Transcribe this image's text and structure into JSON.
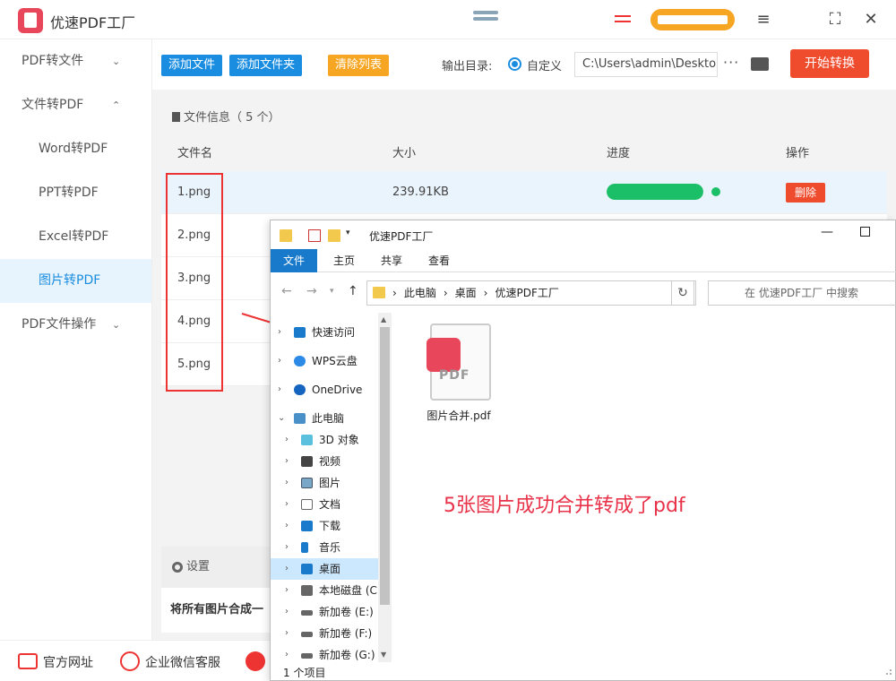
{
  "app": {
    "title": "优速PDF工厂"
  },
  "sidebar": {
    "items": [
      {
        "label": "PDF转文件",
        "chevron": "⌄"
      },
      {
        "label": "文件转PDF",
        "chevron": "⌃"
      },
      {
        "label": "Word转PDF"
      },
      {
        "label": "PPT转PDF"
      },
      {
        "label": "Excel转PDF"
      },
      {
        "label": "图片转PDF"
      },
      {
        "label": "PDF文件操作",
        "chevron": "⌄"
      }
    ]
  },
  "toolbar": {
    "add_file": "添加文件",
    "add_folder": "添加文件夹",
    "clear_list": "清除列表",
    "output_label": "输出目录:",
    "custom_label": "自定义",
    "output_path": "C:\\Users\\admin\\Deskto",
    "more": "···",
    "start": "开始转换"
  },
  "file_info": {
    "label": "文件信息（ 5 个）"
  },
  "table": {
    "headers": {
      "name": "文件名",
      "size": "大小",
      "progress": "进度",
      "action": "操作"
    },
    "rows": [
      {
        "name": "1.png",
        "size": "239.91KB",
        "progress": 1.0,
        "action": "删除"
      },
      {
        "name": "2.png"
      },
      {
        "name": "3.png"
      },
      {
        "name": "4.png"
      },
      {
        "name": "5.png"
      }
    ]
  },
  "settings": {
    "label": "设置",
    "text": "将所有图片合成一"
  },
  "footer": {
    "website": "官方网址",
    "wechat": "企业微信客服"
  },
  "explorer": {
    "title": "优速PDF工厂",
    "ribbon": [
      "文件",
      "主页",
      "共享",
      "查看"
    ],
    "breadcrumb": [
      "此电脑",
      "桌面",
      "优速PDF工厂"
    ],
    "search_placeholder": "在 优速PDF工厂 中搜索",
    "nav": [
      {
        "label": "快速访问",
        "level": 0
      },
      {
        "label": "WPS云盘",
        "level": 0
      },
      {
        "label": "OneDrive",
        "level": 0
      },
      {
        "label": "此电脑",
        "level": 0,
        "open": true
      },
      {
        "label": "3D 对象",
        "level": 1
      },
      {
        "label": "视频",
        "level": 1
      },
      {
        "label": "图片",
        "level": 1
      },
      {
        "label": "文档",
        "level": 1
      },
      {
        "label": "下载",
        "level": 1
      },
      {
        "label": "音乐",
        "level": 1
      },
      {
        "label": "桌面",
        "level": 1,
        "selected": true
      },
      {
        "label": "本地磁盘 (C:",
        "level": 1
      },
      {
        "label": "新加卷 (E:)",
        "level": 1
      },
      {
        "label": "新加卷 (F:)",
        "level": 1
      },
      {
        "label": "新加卷 (G:)",
        "level": 1
      }
    ],
    "file": {
      "name": "图片合并.pdf",
      "icon_text": "PDF"
    },
    "status": "1 个项目"
  },
  "annotation": {
    "note": "5张图片成功合并转成了pdf"
  },
  "colors": {
    "brand_blue": "#1a8de0",
    "accent_red": "#ef4b2d",
    "progress_green": "#1bbf68",
    "note_red": "#e8334a"
  }
}
